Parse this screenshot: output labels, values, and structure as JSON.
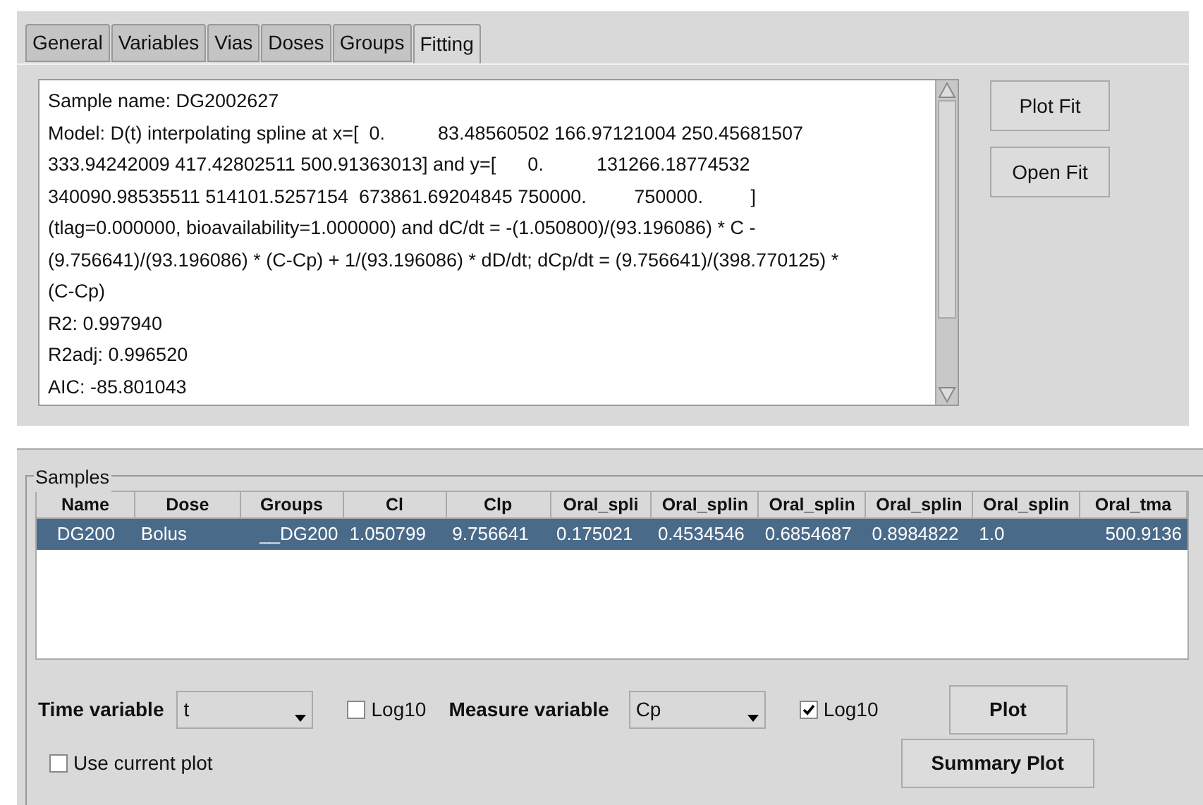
{
  "tabs": [
    {
      "label": "General",
      "selected": false
    },
    {
      "label": "Variables",
      "selected": false
    },
    {
      "label": "Vias",
      "selected": false
    },
    {
      "label": "Doses",
      "selected": false
    },
    {
      "label": "Groups",
      "selected": false
    },
    {
      "label": "Fitting",
      "selected": true
    }
  ],
  "output_lines": [
    "Sample name: DG2002627",
    "Model: D(t) interpolating spline at x=[  0.          83.48560502 166.97121004 250.45681507",
    "333.94242009 417.42802511 500.91363013] and y=[      0.          131266.18774532",
    "340090.98535511 514101.5257154  673861.69204845 750000.         750000.         ]",
    "(tlag=0.000000, bioavailability=1.000000) and dC/dt = -(1.050800)/(93.196086) * C -",
    "(9.756641)/(93.196086) * (C-Cp) + 1/(93.196086) * dD/dt; dCp/dt = (9.756641)/(398.770125) *",
    "(C-Cp)",
    "R2: 0.997940",
    "R2adj: 0.996520",
    "AIC: -85.801043"
  ],
  "fit_buttons": [
    "Plot Fit",
    "Open Fit"
  ],
  "samples": {
    "title": "Samples",
    "columns": [
      "Name",
      "Dose",
      "Groups",
      "Cl",
      "Clp",
      "Oral_spli",
      "Oral_splin",
      "Oral_splin",
      "Oral_splin",
      "Oral_splin",
      "Oral_tma"
    ],
    "rows": [
      {
        "selected": true,
        "cells": [
          "DG200",
          "Bolus",
          "__DG200",
          "1.050799",
          "9.756641",
          "0.175021",
          "0.4534546",
          "0.6854687",
          "0.8984822",
          "1.0",
          "500.9136"
        ]
      }
    ]
  },
  "time_variable": {
    "label": "Time variable",
    "value": "t",
    "log10": {
      "label": "Log10",
      "checked": false
    }
  },
  "measure_variable": {
    "label": "Measure variable",
    "value": "Cp",
    "log10": {
      "label": "Log10",
      "checked": true
    }
  },
  "use_current_plot": {
    "label": "Use current plot",
    "checked": false
  },
  "plot_buttons": [
    "Plot",
    "Summary Plot"
  ]
}
